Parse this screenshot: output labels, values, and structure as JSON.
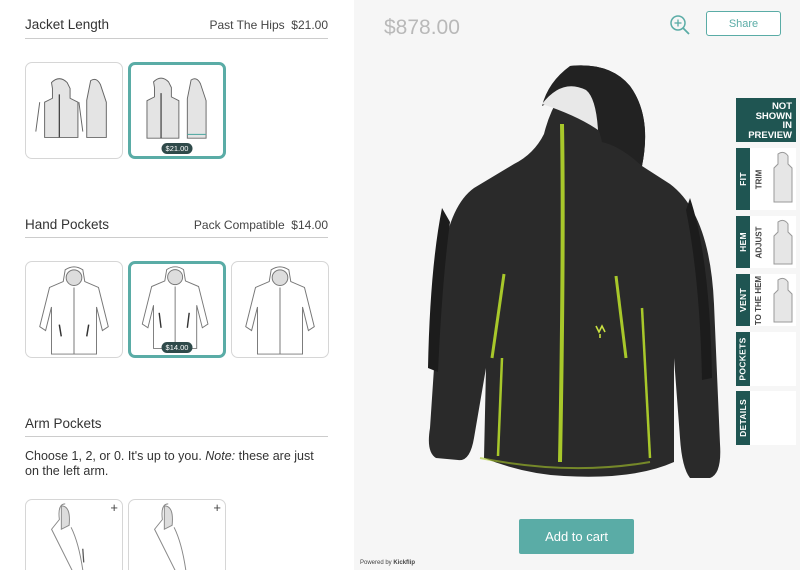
{
  "sections": {
    "jacket_length": {
      "title": "Jacket Length",
      "selected_value": "Past The Hips",
      "selected_price": "$21.00",
      "option_price": "$21.00"
    },
    "hand_pockets": {
      "title": "Hand Pockets",
      "selected_value": "Pack Compatible",
      "selected_price": "$14.00",
      "option_price": "$14.00"
    },
    "arm_pockets": {
      "title": "Arm Pockets",
      "desc_main": "Choose 1, 2, or 0. It's up to you.",
      "desc_note_label": "Note:",
      "desc_note": "these are just on the left arm.",
      "add_symbol": "+"
    }
  },
  "preview": {
    "total_price": "$878.00",
    "share_label": "Share",
    "add_to_cart_label": "Add to cart",
    "powered_by_prefix": "Powered by",
    "powered_by_brand": "Kickflip",
    "jacket_color": "#2a2a2a",
    "zip_color": "#a8c82a"
  },
  "side_tabs": {
    "not_shown": [
      "NOT",
      "SHOWN",
      "IN",
      "PREVIEW"
    ],
    "fit": {
      "label": "FIT",
      "sub": "TRIM"
    },
    "hem": {
      "label": "HEM",
      "sub": "ADJUST"
    },
    "vent": {
      "label": "VENT",
      "sub1": "TO THE",
      "sub2": "HEM"
    },
    "pockets": {
      "label": "POCKETS"
    },
    "details": {
      "label": "DETAILS"
    }
  },
  "icons": {
    "zoom": "zoom-in-icon"
  },
  "colors": {
    "accent": "#5aaca6",
    "dark_teal": "#1f5552"
  }
}
